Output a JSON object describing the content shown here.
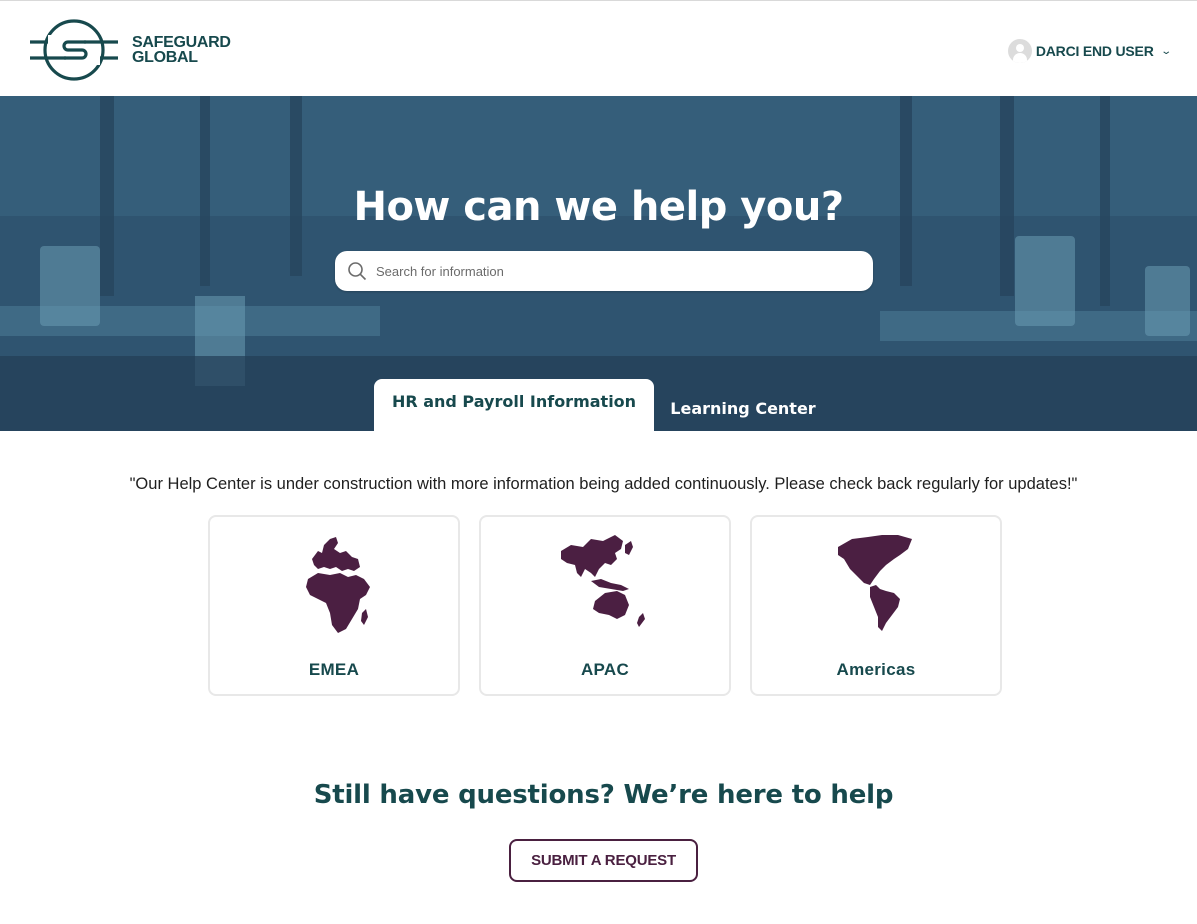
{
  "header": {
    "logo_line1": "SAFEGUARD",
    "logo_line2": "GLOBAL",
    "user_name": "DARCI END USER",
    "user_menu_icon": "chevron-down-icon",
    "avatar_icon": "user-avatar-icon"
  },
  "hero": {
    "title": "How can we help you?",
    "search": {
      "placeholder": "Search for information",
      "value": "",
      "icon": "search-icon"
    },
    "tabs": [
      {
        "label": "HR and Payroll Information",
        "active": true
      },
      {
        "label": "Learning Center",
        "active": false
      }
    ]
  },
  "main": {
    "notice": "\"Our Help Center is under construction with more information being added continuously. Please check back regularly for updates!\"",
    "regions": [
      {
        "label": "EMEA",
        "icon": "europe-africa-map-icon"
      },
      {
        "label": "APAC",
        "icon": "asia-pacific-map-icon"
      },
      {
        "label": "Americas",
        "icon": "americas-map-icon"
      }
    ],
    "help_title": "Still have questions? We’re here to help",
    "submit_label": "SUBMIT A REQUEST"
  },
  "colors": {
    "brand_teal": "#17494d",
    "accent_plum": "#4a2040",
    "map_fill": "#4b1f42"
  }
}
